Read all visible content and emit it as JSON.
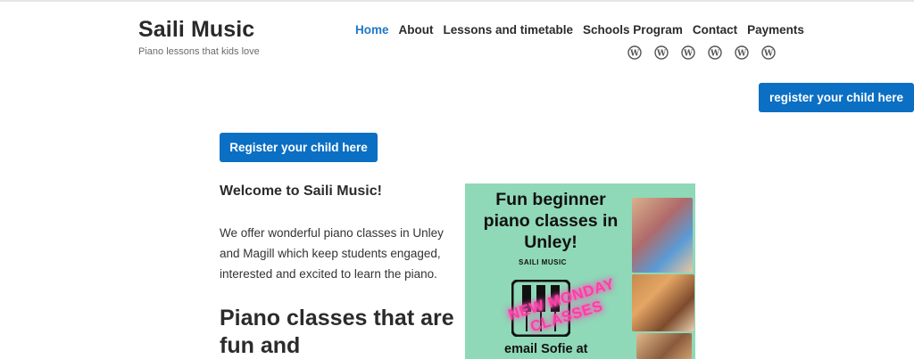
{
  "site": {
    "title": "Saili Music",
    "tagline": "Piano lessons that kids love"
  },
  "nav": {
    "items": [
      {
        "label": "Home",
        "active": true
      },
      {
        "label": "About",
        "active": false
      },
      {
        "label": "Lessons and timetable",
        "active": false
      },
      {
        "label": "Schools Program",
        "active": false
      },
      {
        "label": "Contact",
        "active": false
      },
      {
        "label": "Payments",
        "active": false
      }
    ]
  },
  "social": {
    "icons": [
      "wordpress-icon",
      "wordpress-icon",
      "wordpress-icon",
      "wordpress-icon",
      "wordpress-icon",
      "wordpress-icon"
    ]
  },
  "header_button": {
    "label": "register your child here"
  },
  "main": {
    "register_button": "Register your child here",
    "welcome": "Welcome to Saili Music!",
    "intro": "We offer wonderful piano classes in Unley and Magill which keep students engaged, interested and excited to learn the piano.",
    "heading": "Piano classes that are fun and"
  },
  "poster": {
    "title": "Fun beginner piano classes in Unley!",
    "brand": "SAILI MUSIC",
    "neon": "NEW MONDAY CLASSES",
    "email": "email Sofie at"
  },
  "colors": {
    "accent": "#0b6fc4",
    "nav_active": "#1e78c8",
    "poster_bg": "#8fd8b8",
    "neon": "#ff3ea5"
  }
}
